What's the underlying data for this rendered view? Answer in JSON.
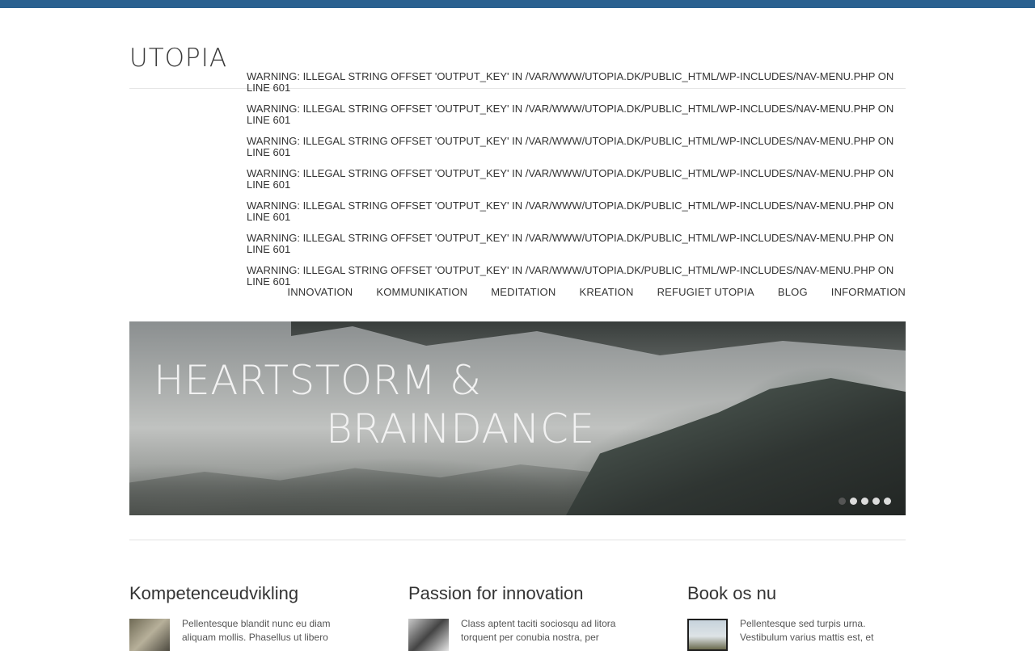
{
  "header": {
    "logo_text": "UTOPIA",
    "brand_color": "#2a6190"
  },
  "warnings": [
    "Warning: Illegal string offset 'output_key' in /var/www/utopia.dk/public_html/wp-includes/nav-menu.php on line 601",
    "Warning: Illegal string offset 'output_key' in /var/www/utopia.dk/public_html/wp-includes/nav-menu.php on line 601",
    "Warning: Illegal string offset 'output_key' in /var/www/utopia.dk/public_html/wp-includes/nav-menu.php on line 601",
    "Warning: Illegal string offset 'output_key' in /var/www/utopia.dk/public_html/wp-includes/nav-menu.php on line 601",
    "Warning: Illegal string offset 'output_key' in /var/www/utopia.dk/public_html/wp-includes/nav-menu.php on line 601",
    "Warning: Illegal string offset 'output_key' in /var/www/utopia.dk/public_html/wp-includes/nav-menu.php on line 601",
    "Warning: Illegal string offset 'output_key' in /var/www/utopia.dk/public_html/wp-includes/nav-menu.php on line 601"
  ],
  "nav": {
    "items": [
      "INNOVATION",
      "KOMMUNIKATION",
      "MEDITATION",
      "KREATION",
      "REFUGIET UTOPIA",
      "BLOG",
      "INFORMATION"
    ]
  },
  "hero": {
    "line1": "HEARTSTORM &",
    "line2": "BRAINDANCE",
    "active_slide": 1,
    "slide_count": 5
  },
  "columns": [
    {
      "title": "Kompetenceudvikling",
      "text": "Pellentesque blandit nunc eu diam aliquam mollis. Phasellus ut libero"
    },
    {
      "title": "Passion for innovation",
      "text": "Class aptent taciti sociosqu ad litora torquent per conubia nostra, per"
    },
    {
      "title": "Book os nu",
      "text": "Pellentesque sed turpis urna. Vestibulum varius mattis est, et"
    }
  ]
}
